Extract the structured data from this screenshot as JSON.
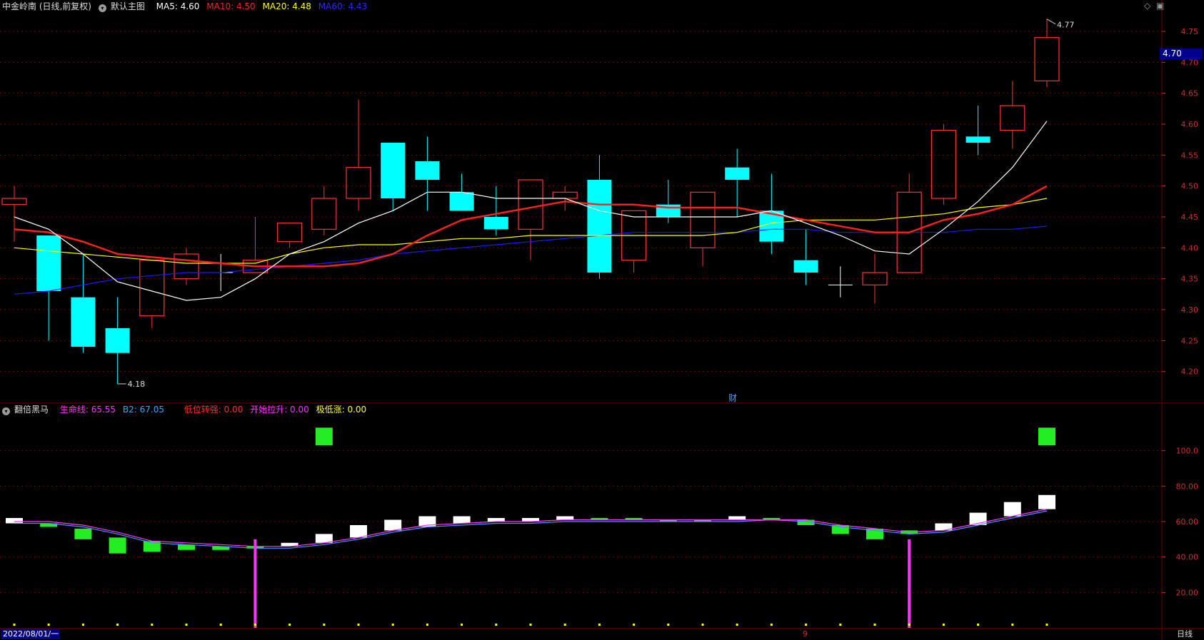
{
  "price_panel": {
    "stock_name": "中金岭南 (日线,前复权)",
    "main_chart_label": "默认主图",
    "ma_labels": [
      {
        "text": "MA5: 4.60",
        "color": "#ffffff"
      },
      {
        "text": "MA10: 4.50",
        "color": "#ff2020"
      },
      {
        "text": "MA20: 4.48",
        "color": "#ffff00"
      },
      {
        "text": "MA60: 4.43",
        "color": "#2b2bff"
      }
    ],
    "y_ticks": [
      "4.75",
      "4.70",
      "4.65",
      "4.60",
      "4.55",
      "4.50",
      "4.45",
      "4.40",
      "4.35",
      "4.30",
      "4.25",
      "4.20"
    ],
    "current_price_tag": "4.70",
    "max_label": "4.77",
    "min_label": "4.18",
    "fin_marker": "财",
    "top_right_icons": [
      "diamond-icon",
      "window-icon"
    ]
  },
  "indicator_panel": {
    "name": "翻倍黑马",
    "labels": [
      {
        "text": "生命线: 65.55",
        "color": "#ff33ff"
      },
      {
        "text": "B2: 67.05",
        "color": "#33aaff"
      },
      {
        "text": "低位转强: 0.00",
        "color": "#ff3030"
      },
      {
        "text": "开始拉升: 0.00",
        "color": "#ff33ff"
      },
      {
        "text": "极低涨: 0.00",
        "color": "#ffff33"
      }
    ],
    "y_ticks": [
      "100.0",
      "80.00",
      "60.00",
      "40.00",
      "20.00"
    ]
  },
  "bottom_bar": {
    "date_label": "2022/08/01/一",
    "month_marker": "9",
    "period_label": "日线"
  },
  "colors": {
    "up": "#ff3232",
    "down": "#00ffff",
    "ma5": "#ffffff",
    "ma10": "#ff2020",
    "ma20": "#ffff00",
    "ma60": "#1a1aff",
    "grid": "#7a0000",
    "axis_text": "#c83232"
  },
  "chart_data": [
    {
      "type": "candlestick",
      "title": "",
      "ylim": [
        4.15,
        4.78
      ],
      "candles": [
        {
          "o": 4.47,
          "h": 4.5,
          "l": 4.41,
          "c": 4.48
        },
        {
          "o": 4.42,
          "h": 4.42,
          "l": 4.25,
          "c": 4.33
        },
        {
          "o": 4.32,
          "h": 4.39,
          "l": 4.23,
          "c": 4.24
        },
        {
          "o": 4.27,
          "h": 4.32,
          "l": 4.18,
          "c": 4.23
        },
        {
          "o": 4.29,
          "h": 4.38,
          "l": 4.27,
          "c": 4.38
        },
        {
          "o": 4.35,
          "h": 4.4,
          "l": 4.34,
          "c": 4.39
        },
        {
          "o": 4.36,
          "h": 4.39,
          "l": 4.33,
          "c": 4.36
        },
        {
          "o": 4.36,
          "h": 4.45,
          "l": 4.36,
          "c": 4.38
        },
        {
          "o": 4.41,
          "h": 4.44,
          "l": 4.4,
          "c": 4.44
        },
        {
          "o": 4.43,
          "h": 4.5,
          "l": 4.42,
          "c": 4.48
        },
        {
          "o": 4.48,
          "h": 4.64,
          "l": 4.46,
          "c": 4.53
        },
        {
          "o": 4.57,
          "h": 4.57,
          "l": 4.46,
          "c": 4.48
        },
        {
          "o": 4.54,
          "h": 4.58,
          "l": 4.46,
          "c": 4.51
        },
        {
          "o": 4.49,
          "h": 4.52,
          "l": 4.46,
          "c": 4.46
        },
        {
          "o": 4.45,
          "h": 4.5,
          "l": 4.42,
          "c": 4.43
        },
        {
          "o": 4.43,
          "h": 4.51,
          "l": 4.38,
          "c": 4.51
        },
        {
          "o": 4.48,
          "h": 4.5,
          "l": 4.46,
          "c": 4.49
        },
        {
          "o": 4.51,
          "h": 4.55,
          "l": 4.35,
          "c": 4.36
        },
        {
          "o": 4.38,
          "h": 4.46,
          "l": 4.36,
          "c": 4.46
        },
        {
          "o": 4.47,
          "h": 4.51,
          "l": 4.44,
          "c": 4.45
        },
        {
          "o": 4.4,
          "h": 4.49,
          "l": 4.37,
          "c": 4.49
        },
        {
          "o": 4.53,
          "h": 4.56,
          "l": 4.45,
          "c": 4.51
        },
        {
          "o": 4.46,
          "h": 4.52,
          "l": 4.39,
          "c": 4.41
        },
        {
          "o": 4.38,
          "h": 4.43,
          "l": 4.34,
          "c": 4.36
        },
        {
          "o": 4.34,
          "h": 4.37,
          "l": 4.32,
          "c": 4.34
        },
        {
          "o": 4.34,
          "h": 4.39,
          "l": 4.31,
          "c": 4.36
        },
        {
          "o": 4.36,
          "h": 4.52,
          "l": 4.36,
          "c": 4.49
        },
        {
          "o": 4.48,
          "h": 4.6,
          "l": 4.47,
          "c": 4.59
        },
        {
          "o": 4.58,
          "h": 4.63,
          "l": 4.55,
          "c": 4.57
        },
        {
          "o": 4.59,
          "h": 4.67,
          "l": 4.56,
          "c": 4.63
        },
        {
          "o": 4.67,
          "h": 4.77,
          "l": 4.66,
          "c": 4.74
        }
      ],
      "ma5": [
        4.45,
        4.43,
        4.39,
        4.345,
        4.33,
        4.315,
        4.32,
        4.35,
        4.39,
        4.41,
        4.44,
        4.46,
        4.49,
        4.49,
        4.48,
        4.48,
        4.48,
        4.46,
        4.45,
        4.45,
        4.45,
        4.45,
        4.46,
        4.44,
        4.42,
        4.395,
        4.39,
        4.43,
        4.475,
        4.53,
        4.605
      ],
      "ma10": [
        4.43,
        4.425,
        4.41,
        4.39,
        4.385,
        4.38,
        4.375,
        4.37,
        4.37,
        4.37,
        4.375,
        4.39,
        4.42,
        4.445,
        4.455,
        4.465,
        4.475,
        4.47,
        4.47,
        4.465,
        4.465,
        4.465,
        4.455,
        4.445,
        4.435,
        4.425,
        4.425,
        4.445,
        4.455,
        4.47,
        4.5
      ],
      "ma20": [
        4.4,
        4.395,
        4.39,
        4.385,
        4.38,
        4.375,
        4.375,
        4.375,
        4.39,
        4.4,
        4.405,
        4.405,
        4.41,
        4.415,
        4.415,
        4.42,
        4.42,
        4.42,
        4.42,
        4.42,
        4.42,
        4.425,
        4.44,
        4.445,
        4.445,
        4.445,
        4.45,
        4.455,
        4.465,
        4.47,
        4.48
      ],
      "ma60": [
        4.325,
        4.33,
        4.34,
        4.35,
        4.355,
        4.36,
        4.36,
        4.365,
        4.37,
        4.375,
        4.38,
        4.39,
        4.395,
        4.4,
        4.405,
        4.41,
        4.415,
        4.42,
        4.425,
        4.425,
        4.425,
        4.425,
        4.43,
        4.43,
        4.425,
        4.425,
        4.425,
        4.425,
        4.43,
        4.43,
        4.435
      ]
    },
    {
      "type": "bar",
      "title": "",
      "ylim": [
        0,
        120
      ],
      "bars": [
        {
          "top": 62,
          "bottom": 59,
          "color": "white"
        },
        {
          "top": 59,
          "bottom": 57,
          "color": "green"
        },
        {
          "top": 56,
          "bottom": 50,
          "color": "green"
        },
        {
          "top": 51,
          "bottom": 42,
          "color": "green"
        },
        {
          "top": 49,
          "bottom": 43,
          "color": "green"
        },
        {
          "top": 47,
          "bottom": 44,
          "color": "green"
        },
        {
          "top": 46,
          "bottom": 44,
          "color": "green"
        },
        {
          "top": 46,
          "bottom": 45,
          "color": "green"
        },
        {
          "top": 48,
          "bottom": 46,
          "color": "white"
        },
        {
          "top": 53,
          "bottom": 48,
          "color": "white"
        },
        {
          "top": 58,
          "bottom": 51,
          "color": "white"
        },
        {
          "top": 61,
          "bottom": 55,
          "color": "white"
        },
        {
          "top": 63,
          "bottom": 57,
          "color": "white"
        },
        {
          "top": 63,
          "bottom": 59,
          "color": "white"
        },
        {
          "top": 62,
          "bottom": 60,
          "color": "white"
        },
        {
          "top": 62,
          "bottom": 60,
          "color": "white"
        },
        {
          "top": 63,
          "bottom": 61,
          "color": "white"
        },
        {
          "top": 62,
          "bottom": 61,
          "color": "green"
        },
        {
          "top": 62,
          "bottom": 61,
          "color": "green"
        },
        {
          "top": 61,
          "bottom": 60,
          "color": "green"
        },
        {
          "top": 61,
          "bottom": 60,
          "color": "green"
        },
        {
          "top": 63,
          "bottom": 61,
          "color": "white"
        },
        {
          "top": 62,
          "bottom": 61,
          "color": "green"
        },
        {
          "top": 61,
          "bottom": 58,
          "color": "green"
        },
        {
          "top": 58,
          "bottom": 53,
          "color": "green"
        },
        {
          "top": 56,
          "bottom": 50,
          "color": "green"
        },
        {
          "top": 55,
          "bottom": 53,
          "color": "green"
        },
        {
          "top": 59,
          "bottom": 55,
          "color": "white"
        },
        {
          "top": 65,
          "bottom": 58,
          "color": "white"
        },
        {
          "top": 71,
          "bottom": 63,
          "color": "white"
        },
        {
          "top": 75,
          "bottom": 67,
          "color": "white"
        }
      ],
      "life_line": [
        60,
        60,
        58,
        54,
        49,
        48,
        47,
        46,
        46,
        48,
        51,
        55,
        58,
        59,
        60,
        60,
        61,
        61,
        61,
        61,
        61,
        61,
        61,
        61,
        58,
        56,
        54,
        55,
        59,
        63,
        67
      ],
      "b2_line": [
        59,
        59,
        57,
        53,
        48,
        47,
        46,
        45,
        45,
        47,
        50,
        54,
        57,
        58,
        59,
        59,
        60,
        60,
        60,
        60,
        60,
        60,
        61,
        60,
        57,
        55,
        53,
        54,
        58,
        62,
        66
      ],
      "big_green_at": [
        9,
        30
      ],
      "big_green_range": [
        103,
        113
      ],
      "magenta_spikes_at": [
        7,
        26
      ],
      "magenta_spike_top": 50,
      "yellow_dots": true
    }
  ]
}
